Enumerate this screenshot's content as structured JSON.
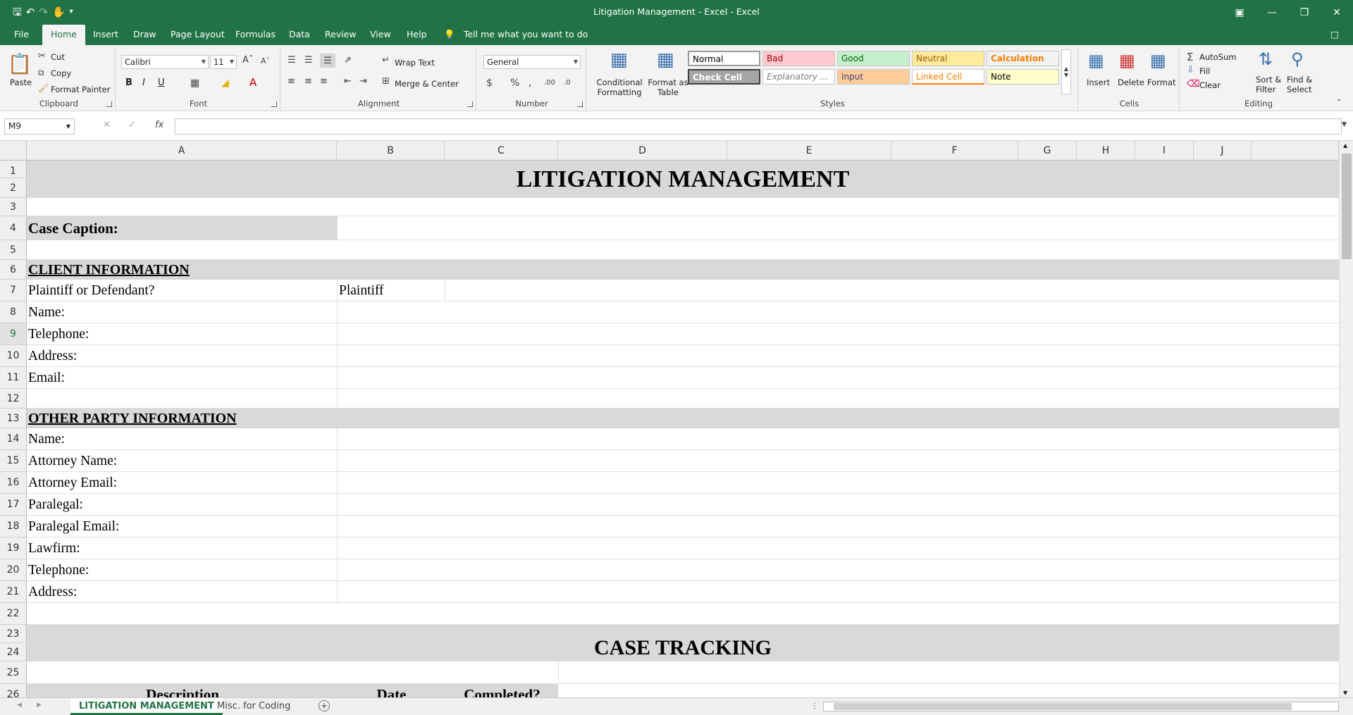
{
  "window": {
    "title": "Litigation Management - Excel - Excel"
  },
  "ribbon_tabs": [
    "File",
    "Home",
    "Insert",
    "Draw",
    "Page Layout",
    "Formulas",
    "Data",
    "Review",
    "View",
    "Help"
  ],
  "tell_me": "Tell me what you want to do",
  "clipboard": {
    "paste": "Paste",
    "cut": "Cut",
    "copy": "Copy",
    "format_painter": "Format Painter",
    "label": "Clipboard"
  },
  "font": {
    "name": "Calibri",
    "size": "11",
    "bold": "B",
    "italic": "I",
    "underline": "U",
    "label": "Font"
  },
  "alignment": {
    "wrap_text": "Wrap Text",
    "merge_center": "Merge & Center",
    "label": "Alignment"
  },
  "number": {
    "format": "General",
    "label": "Number"
  },
  "styles": {
    "conditional_formatting": "Conditional Formatting",
    "format_as_table": "Format as Table",
    "items": [
      {
        "name": "Normal",
        "bg": "#ffffff",
        "fg": "#000000"
      },
      {
        "name": "Bad",
        "bg": "#ffc7ce",
        "fg": "#9c0006"
      },
      {
        "name": "Good",
        "bg": "#c6efce",
        "fg": "#006100"
      },
      {
        "name": "Neutral",
        "bg": "#ffeb9c",
        "fg": "#9c5700"
      },
      {
        "name": "Calculation",
        "bg": "#f2f2f2",
        "fg": "#fa7d00"
      },
      {
        "name": "Check Cell",
        "bg": "#a5a5a5",
        "fg": "#ffffff"
      },
      {
        "name": "Explanatory ...",
        "bg": "#ffffff",
        "fg": "#7f7f7f"
      },
      {
        "name": "Input",
        "bg": "#ffcc99",
        "fg": "#3f3f76"
      },
      {
        "name": "Linked Cell",
        "bg": "#ffffff",
        "fg": "#fa7d00"
      },
      {
        "name": "Note",
        "bg": "#ffffcc",
        "fg": "#000000"
      }
    ],
    "label": "Styles"
  },
  "cells_group": {
    "insert": "Insert",
    "delete": "Delete",
    "format": "Format",
    "label": "Cells"
  },
  "editing": {
    "autosum": "AutoSum",
    "fill": "Fill",
    "clear": "Clear",
    "sort_filter": "Sort & Filter",
    "find_select": "Find & Select",
    "label": "Editing"
  },
  "formula_bar": {
    "name_box": "M9",
    "fx": "fx",
    "content": ""
  },
  "columns": [
    "A",
    "B",
    "C",
    "D",
    "E",
    "F",
    "G",
    "H",
    "I",
    "J"
  ],
  "rows": [
    "1",
    "2",
    "3",
    "4",
    "5",
    "6",
    "7",
    "8",
    "9",
    "10",
    "11",
    "12",
    "13",
    "14",
    "15",
    "16",
    "17",
    "18",
    "19",
    "20",
    "21",
    "22",
    "23",
    "24",
    "25",
    "26"
  ],
  "sheet": {
    "title": "LITIGATION MANAGEMENT",
    "case_caption": "Case Caption:",
    "client_header": "CLIENT INFORMATION",
    "client_fields": [
      "Plaintiff or Defendant?",
      "Name:",
      "Telephone:",
      "Address:",
      "Email:"
    ],
    "plaintiff_value": "Plaintiff",
    "other_header": "OTHER PARTY INFORMATION",
    "other_fields": [
      "Name:",
      "Attorney Name:",
      "Attorney Email:",
      "Paralegal:",
      "Paralegal Email:",
      "Lawfirm:",
      "Telephone:",
      "Address:"
    ],
    "case_tracking": "CASE TRACKING",
    "col_description": "Description",
    "col_date": "Date",
    "col_completed": "Completed?"
  },
  "sheet_tabs": [
    "LITIGATION MANAGEMENT",
    "Misc. for Coding"
  ]
}
